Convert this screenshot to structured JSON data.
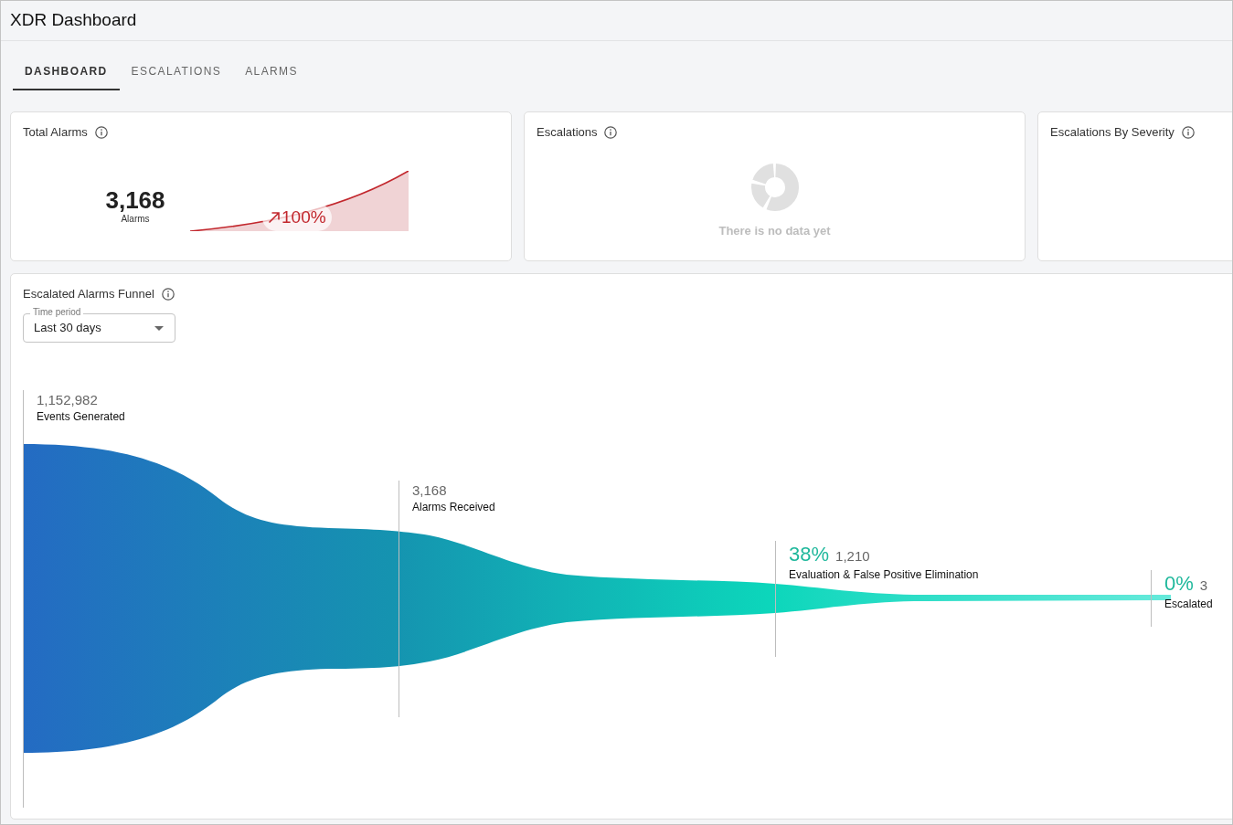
{
  "window": {
    "title": "XDR Dashboard"
  },
  "tabs": [
    {
      "label": "DASHBOARD",
      "selected": true
    },
    {
      "label": "ESCALATIONS",
      "selected": false
    },
    {
      "label": "ALARMS",
      "selected": false
    }
  ],
  "cards": [
    {
      "kind": "kpi",
      "title": "Total Alarms",
      "value": "3,168",
      "unit": "Alarms",
      "trend": "100%"
    },
    {
      "kind": "empty",
      "title": "Escalations",
      "message": "There is no data yet"
    },
    {
      "kind": "blank",
      "title": "Escalations By Severity"
    }
  ],
  "funnel": {
    "title": "Escalated Alarms Funnel",
    "time_period": {
      "label": "Time period",
      "value": "Last 30 days"
    },
    "stages": [
      {
        "value": "1,152,982",
        "label": "Events Generated"
      },
      {
        "value": "3,168",
        "label": "Alarms Received"
      },
      {
        "percent": "38%",
        "value": "1,210",
        "label": "Evaluation & False Positive Elimination"
      },
      {
        "percent": "0%",
        "value": "3",
        "label": "Escalated"
      }
    ]
  }
}
